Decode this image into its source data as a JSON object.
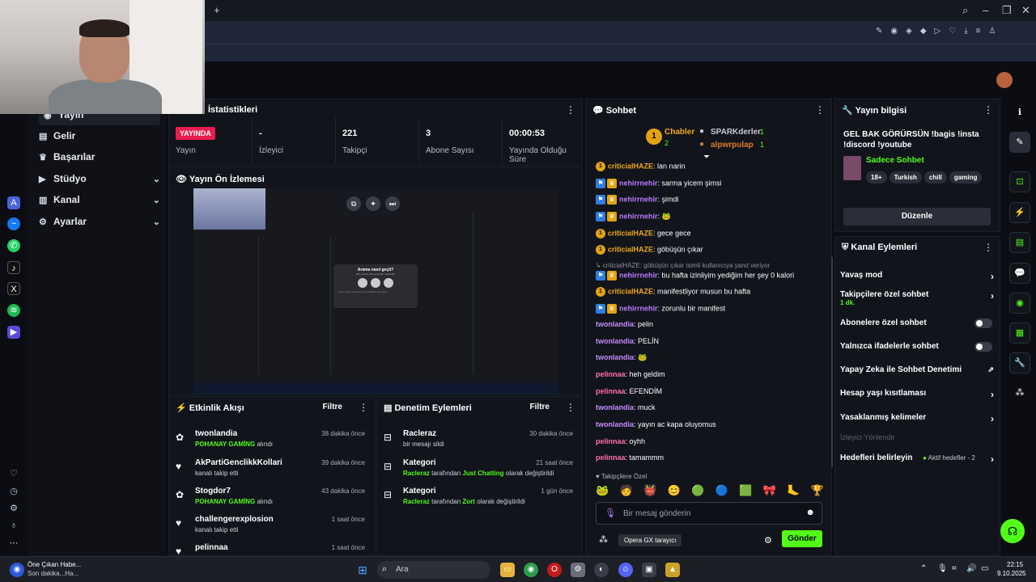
{
  "browser": {
    "tab_controls": {
      "new_tab": "+"
    },
    "window_controls": {
      "search": "⌕",
      "minimize": "–",
      "maximize": "❐",
      "close": "✕"
    }
  },
  "sidebar": {
    "items": [
      {
        "label": "Yayın",
        "icon": "broadcast-icon"
      },
      {
        "label": "Gelir",
        "icon": "wallet-icon"
      },
      {
        "label": "Başarılar",
        "icon": "trophy-icon"
      },
      {
        "label": "Stüdyo",
        "icon": "studio-icon",
        "chevron": "⌄"
      },
      {
        "label": "Kanal",
        "icon": "channel-icon",
        "chevron": "⌄"
      },
      {
        "label": "Ayarlar",
        "icon": "gear-icon",
        "chevron": "⌄"
      }
    ]
  },
  "stats": {
    "title": "İstatistikleri",
    "live_badge": "YAYINDA",
    "cells": [
      {
        "value": "",
        "label": "Yayın"
      },
      {
        "value": "-",
        "label": "İzleyici"
      },
      {
        "value": "221",
        "label": "Takipçi"
      },
      {
        "value": "3",
        "label": "Abone Sayısı"
      },
      {
        "value": "00:00:53",
        "label": "Yayında Olduğu Süre"
      }
    ]
  },
  "preview": {
    "title": "Yayın Ön İzlemesi",
    "dialog_title": "Arama nasıl geçti?",
    "dialog_sub": "Bize arama deneyiminden bahsedin",
    "dialog_footer": "Bunu tekrar görmek için geri bildirim gönderin"
  },
  "activity": {
    "title": "Etkinlik Akışı",
    "filter": "Filtre",
    "rows": [
      {
        "name": "twonlandia",
        "sub_prefix": "POHANAY GAMİNG",
        "sub": " alındı",
        "time": "38 dakika önce",
        "icon": "gift-icon"
      },
      {
        "name": "AkPartiGenclikkKollari",
        "sub_prefix": "",
        "sub": "kanalı takip etti",
        "time": "39 dakika önce",
        "icon": "heart-icon"
      },
      {
        "name": "Stogdor7",
        "sub_prefix": "POHANAY GAMİNG",
        "sub": " alındı",
        "time": "43 dakika önce",
        "icon": "gift-icon"
      },
      {
        "name": "challengerexplosion",
        "sub_prefix": "",
        "sub": "kanalı takip etti",
        "time": "1 saat önce",
        "icon": "heart-icon"
      },
      {
        "name": "pelinnaa",
        "sub_prefix": "",
        "sub": "",
        "time": "1 saat önce",
        "icon": "heart-icon"
      }
    ]
  },
  "moderation": {
    "title": "Denetim Eylemleri",
    "filter": "Filtre",
    "rows": [
      {
        "name": "Racleraz",
        "line": "bir mesajı sildi",
        "time": "30 dakika önce"
      },
      {
        "name": "Kategori",
        "actor": "Racleraz",
        "mid": " tarafından ",
        "target": "Just Chatting",
        "end": " olarak değiştirildi",
        "time": "21 saat önce"
      },
      {
        "name": "Kategori",
        "actor": "Racleraz",
        "mid": " tarafından ",
        "target": "Zort",
        "end": " olarak değiştirildi",
        "time": "1 gün önce"
      }
    ]
  },
  "chat": {
    "title": "Sohbet",
    "top1": {
      "name": "Chabler",
      "count": "2",
      "rank": "1"
    },
    "top2": {
      "name": "SPARKderler",
      "count": "1"
    },
    "top3": {
      "name": "alpwrpulap",
      "count": "1"
    },
    "messages": [
      {
        "badges": "one",
        "user": "criticialHAZE",
        "color": "#f0a81f",
        "text": "lan narin"
      },
      {
        "badges": "vip",
        "user": "nehirrnehir",
        "color": "#b77cff",
        "text": "sarma yicem şimsi"
      },
      {
        "badges": "vip",
        "user": "nehirrnehir",
        "color": "#b77cff",
        "text": "şimdi"
      },
      {
        "badges": "vip",
        "user": "nehirrnehir",
        "color": "#b77cff",
        "text": "🐸"
      },
      {
        "badges": "one",
        "user": "criticialHAZE",
        "color": "#f0a81f",
        "text": "gece gece"
      },
      {
        "badges": "one",
        "user": "criticialHAZE",
        "color": "#f0a81f",
        "text": "göbüşün çıkar"
      },
      {
        "badges": "reply",
        "user": "",
        "color": "#8a8f9a",
        "text": "↳ criticialHAZE: göbüşün çıkar isimli kullanıcıya yanıt veriyor"
      },
      {
        "badges": "vip",
        "user": "nehirrnehir",
        "color": "#b77cff",
        "text": "bu hafta izinliyim yediğim her şey 0 kalori"
      },
      {
        "badges": "one",
        "user": "criticialHAZE",
        "color": "#f0a81f",
        "text": "manifestliyor musun bu hafta"
      },
      {
        "badges": "vip",
        "user": "nehirrnehir",
        "color": "#b77cff",
        "text": "zorunlu bir manifest"
      },
      {
        "badges": "",
        "user": "twonlandia",
        "color": "#c58cff",
        "text": "pelin"
      },
      {
        "badges": "",
        "user": "twonlandia",
        "color": "#c58cff",
        "text": "PELİN"
      },
      {
        "badges": "",
        "user": "twonlandia",
        "color": "#c58cff",
        "text": "🐸"
      },
      {
        "badges": "",
        "user": "pelinnaa",
        "color": "#ff6fae",
        "text": "heh geldim"
      },
      {
        "badges": "",
        "user": "pelinnaa",
        "color": "#ff6fae",
        "text": "EFENDİM"
      },
      {
        "badges": "",
        "user": "twonlandia",
        "color": "#c58cff",
        "text": "muck"
      },
      {
        "badges": "",
        "user": "twonlandia",
        "color": "#c58cff",
        "text": "yayın ac kapa oluyomus"
      },
      {
        "badges": "",
        "user": "pelinnaa",
        "color": "#ff6fae",
        "text": "oyhh"
      },
      {
        "badges": "",
        "user": "pelinnaa",
        "color": "#ff6fae",
        "text": "tamammm"
      }
    ],
    "followers_only": "Takipçilere Özel",
    "input_placeholder": "Bir mesaj gönderin",
    "send": "Gönder",
    "tooltip": "Opera GX tarayıcı"
  },
  "info": {
    "title": "Yayın bilgisi",
    "stream_title": "GEL BAK GÖRÜRSÜN !bagis !insta !discord !youtube",
    "category": "Sadece Sohbet",
    "tags": [
      "18+",
      "Turkish",
      "chill",
      "gaming"
    ],
    "edit": "Düzenle"
  },
  "channel_actions": {
    "title": "Kanal Eylemleri",
    "rows": [
      {
        "label": "Yavaş mod",
        "kind": "arrow"
      },
      {
        "label": "Takipçilere özel sohbet",
        "sub": "1 dk.",
        "kind": "arrow"
      },
      {
        "label": "Abonelere özel sohbet",
        "kind": "toggle"
      },
      {
        "label": "Yalnızca ifadelerle sohbet",
        "kind": "toggle"
      },
      {
        "label": "Yapay Zeka ile Sohbet Denetimi",
        "kind": "external"
      },
      {
        "label": "Hesap yaşı kısıtlaması",
        "kind": "arrow"
      },
      {
        "label": "Yasaklanmış kelimeler",
        "kind": "arrow"
      }
    ],
    "section": "İzleyici Yönlendir",
    "goals": "Hedefleri belirleyin",
    "goals_status": "Aktif hedefler - 2"
  },
  "taskbar": {
    "news_title": "Öne Çıkan Habe...",
    "news_sub": "Son dakika...Ha...",
    "search": "Ara",
    "time": "22:15",
    "date": "9.10.2025"
  }
}
